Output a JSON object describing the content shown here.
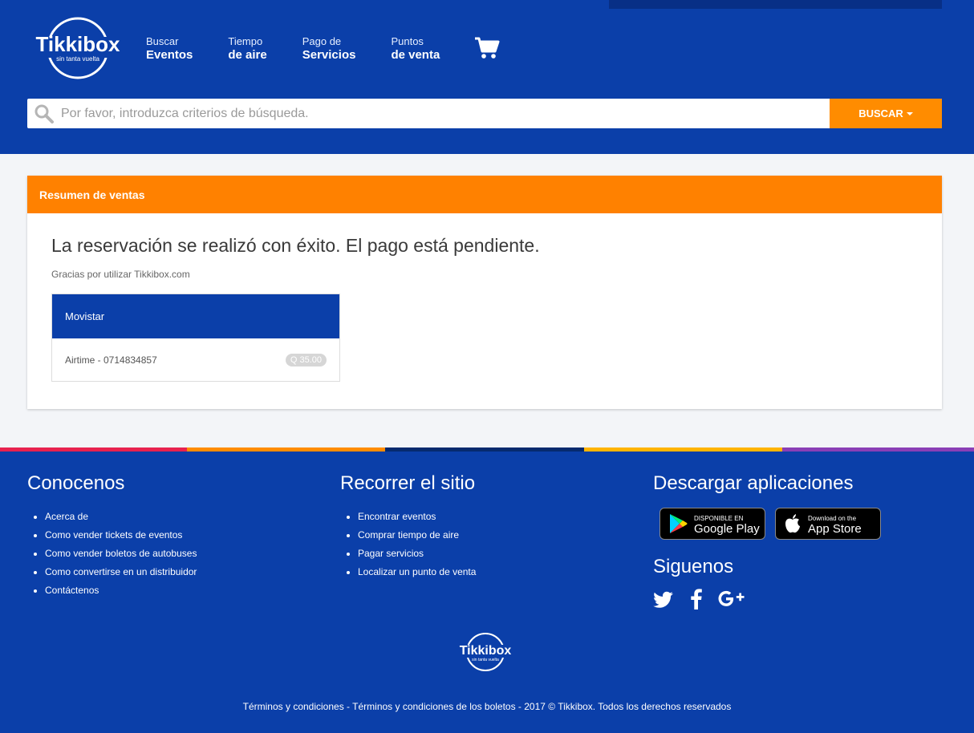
{
  "header": {
    "logo_text": "Tikkibox",
    "logo_tagline": "sin tanta vuelta",
    "nav": [
      {
        "small": "Buscar",
        "big": "Eventos"
      },
      {
        "small": "Tiempo",
        "big": "de aire"
      },
      {
        "small": "Pago de",
        "big": "Servicios"
      },
      {
        "small": "Puntos",
        "big": "de venta"
      }
    ],
    "cart_icon": "shopping-cart-icon"
  },
  "search": {
    "placeholder": "Por favor, introduzca criterios de búsqueda.",
    "button_label": "BUSCAR"
  },
  "panel": {
    "title": "Resumen de ventas",
    "success_message": "La reservación se realizó con éxito. El pago está pendiente.",
    "thanks": "Gracias por utilizar Tikkibox.com",
    "order": {
      "provider": "Movistar",
      "item": "Airtime - 0714834857",
      "amount": "Q 35.00"
    }
  },
  "stripe_colors": [
    "#e8224f",
    "#ff8c00",
    "#062a6e",
    "#ffb400",
    "#8a3fb6"
  ],
  "footer": {
    "col1": {
      "title": "Conocenos",
      "links": [
        "Acerca de",
        "Como vender tickets de eventos",
        "Como vender boletos de autobuses",
        "Como convertirse en un distribuidor",
        "Contáctenos"
      ]
    },
    "col2": {
      "title": "Recorrer el sitio",
      "links": [
        "Encontrar eventos",
        "Comprar tiempo de aire",
        "Pagar servicios",
        "Localizar un punto de venta"
      ]
    },
    "col3": {
      "title": "Descargar aplicaciones",
      "google": {
        "small": "DISPONIBLE EN",
        "big": "Google Play"
      },
      "apple": {
        "small": "Download on the",
        "big": "App Store"
      },
      "follow_title": "Siguenos",
      "social": [
        "twitter-icon",
        "facebook-icon",
        "google-plus-icon"
      ]
    },
    "terms": "Términos y condiciones",
    "sep": " - ",
    "ticket_terms": "Términos y condiciones de los boletos",
    "copyright": " - 2017 © Tikkibox. Todos los derechos reservados"
  }
}
